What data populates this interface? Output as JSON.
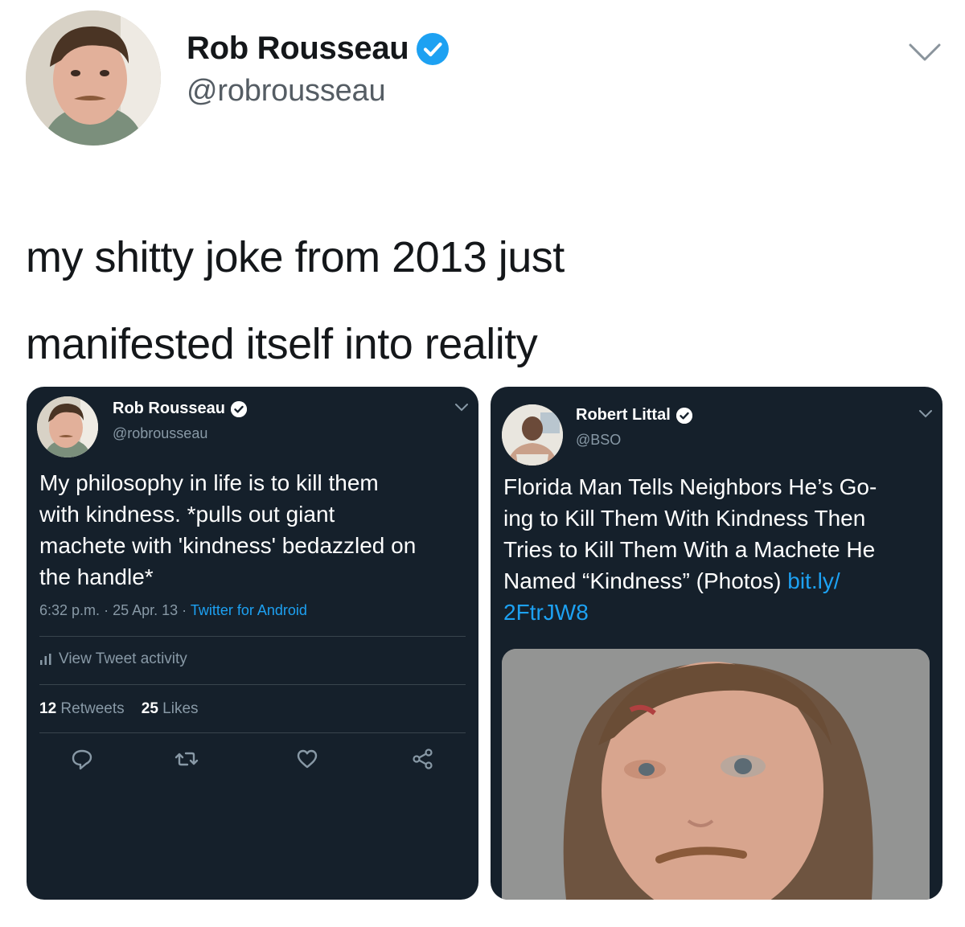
{
  "main_tweet": {
    "author_name": "Rob Rousseau",
    "handle": "@robrousseau",
    "text_line1": "my shitty joke from 2013 just",
    "text_line2": "manifested itself into reality"
  },
  "left_card": {
    "author_name": "Rob Rousseau",
    "handle": "@robrousseau",
    "text_lines": [
      "My philosophy in life is to kill them",
      "with kindness. *pulls out giant",
      "machete with 'kindness' bedazzled on",
      "the handle*"
    ],
    "time": "6:32 p.m.",
    "date": "25 Apr. 13",
    "source": "Twitter for Android",
    "activity_label": "View Tweet activity",
    "retweets_count": "12",
    "retweets_label": "Retweets",
    "likes_count": "25",
    "likes_label": "Likes",
    "actions": [
      "reply-icon",
      "retweet-icon",
      "like-icon",
      "share-icon"
    ]
  },
  "right_card": {
    "author_name": "Robert Littal",
    "handle": "@BSO",
    "text_lines": [
      "Florida Man Tells Neighbors He’s Go-",
      "ing to Kill Them With Kindness Then",
      "Tries to Kill Them With a Machete He"
    ],
    "text_line4": "Named “Kindness” (Photos)",
    "link_part1": "bit.ly/",
    "link_part2": "2FtrJW8"
  },
  "colors": {
    "card_background": "#15202b",
    "verified_blue": "#1da1f2",
    "link_blue": "#1da1f2",
    "muted_gray": "#8899a6"
  }
}
